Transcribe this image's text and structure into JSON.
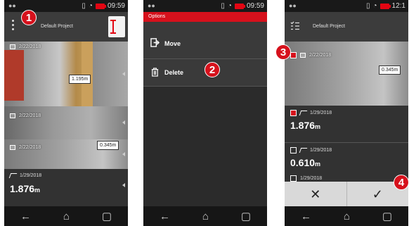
{
  "status": {
    "time": "09:59",
    "time_right": "12:1"
  },
  "callouts": [
    "1",
    "2",
    "3",
    "4"
  ],
  "screen1": {
    "title": "Default Project",
    "items": [
      {
        "date": "2/22/2018",
        "tag": "1.195m"
      },
      {
        "date": "2/22/2018"
      },
      {
        "date": "2/22/2018",
        "tag": "0.345m"
      }
    ],
    "measurement": {
      "date": "1/29/2018",
      "value": "1.876",
      "unit": "m"
    }
  },
  "screen2": {
    "header": "Options",
    "menu": [
      {
        "label": "Move",
        "icon": "move-icon"
      },
      {
        "label": "Delete",
        "icon": "trash-icon"
      }
    ]
  },
  "screen3": {
    "title": "Default Project",
    "photo_item": {
      "date": "2/22/2018",
      "tag": "0.345m"
    },
    "items": [
      {
        "date": "1/29/2018",
        "value": "1.876",
        "unit": "m",
        "checked": true
      },
      {
        "date": "1/29/2018",
        "value": "0.610",
        "unit": "m",
        "checked": false
      },
      {
        "date": "1/29/2018",
        "checked": false
      }
    ],
    "cancel": "✕",
    "confirm": "✓"
  },
  "nav": {
    "back": "←",
    "home": "⌂",
    "recent": "▢"
  },
  "colors": {
    "accent": "#d6111c",
    "background": "#2b2b2b",
    "status_bar": "#191919"
  }
}
